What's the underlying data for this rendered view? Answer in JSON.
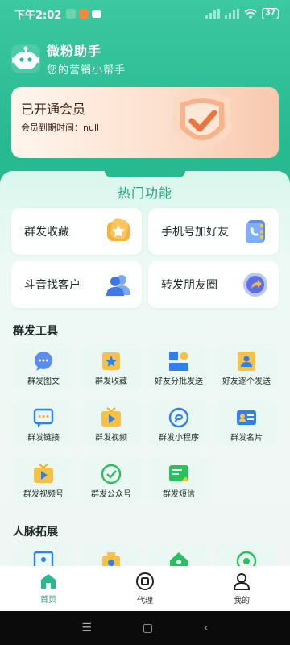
{
  "status_bar": {
    "time": "下午2:02",
    "battery": "37"
  },
  "header": {
    "app_name": "微粉助手",
    "subtitle": "您的营销小帮手"
  },
  "member": {
    "title": "已开通会员",
    "expire_label": "会员到期时间：null"
  },
  "hot": {
    "title": "热门功能",
    "items": [
      {
        "label": "群发收藏",
        "icon": "star-folder-icon"
      },
      {
        "label": "手机号加好友",
        "icon": "contact-book-icon"
      },
      {
        "label": "斗音找客户",
        "icon": "people-icon"
      },
      {
        "label": "转发朋友圈",
        "icon": "share-icon"
      }
    ]
  },
  "mass_tools": {
    "title": "群发工具",
    "items": [
      {
        "label": "群发图文",
        "icon": "chat-bubble-icon"
      },
      {
        "label": "群发收藏",
        "icon": "star-box-icon"
      },
      {
        "label": "好友分批发送",
        "icon": "grid-icon"
      },
      {
        "label": "好友逐个发送",
        "icon": "person-box-icon"
      },
      {
        "label": "群发链接",
        "icon": "message-icon"
      },
      {
        "label": "群发视频",
        "icon": "video-icon"
      },
      {
        "label": "群发小程序",
        "icon": "mini-program-icon"
      },
      {
        "label": "群发名片",
        "icon": "name-card-icon"
      },
      {
        "label": "群发视频号",
        "icon": "channel-icon"
      },
      {
        "label": "群发公众号",
        "icon": "official-account-icon"
      },
      {
        "label": "群发短信",
        "icon": "sms-icon"
      }
    ]
  },
  "network": {
    "title": "人脉拓展"
  },
  "bottom_nav": [
    {
      "label": "首页",
      "icon": "home-icon"
    },
    {
      "label": "代理",
      "icon": "agent-icon"
    },
    {
      "label": "我的",
      "icon": "profile-icon"
    }
  ],
  "colors": {
    "brand": "#27b990",
    "accent_text": "#24a37f",
    "orange": "#f5a623",
    "blue": "#2f80ed"
  }
}
